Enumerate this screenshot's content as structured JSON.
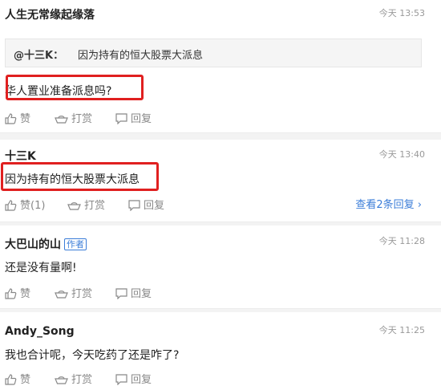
{
  "comments": [
    {
      "name": "人生无常缘起缘落",
      "time": "今天 13:53",
      "quote": {
        "name": "@十三K：",
        "text": "因为持有的恒大股票大派息"
      },
      "text": "华人置业准备派息吗?",
      "actions": {
        "like": "赞",
        "tip": "打赏",
        "reply": "回复"
      }
    },
    {
      "name": "十三K",
      "time": "今天 13:40",
      "text": "因为持有的恒大股票大派息",
      "actions": {
        "like": "赞(1)",
        "tip": "打赏",
        "reply": "回复"
      },
      "more_replies": "查看2条回复"
    },
    {
      "name": "大巴山的山",
      "badge": "作者",
      "time": "今天 11:28",
      "text": "还是没有量啊!",
      "actions": {
        "like": "赞",
        "tip": "打赏",
        "reply": "回复"
      }
    },
    {
      "name": "Andy_Song",
      "time": "今天 11:25",
      "text": "我也合计呢，今天吃药了还是咋了?",
      "actions": {
        "like": "赞",
        "tip": "打赏",
        "reply": "回复"
      }
    }
  ],
  "colors": {
    "highlight": "#e02020",
    "link": "#3b7dd8",
    "muted": "#888888"
  },
  "icons": {
    "like": "thumbs-up-icon",
    "tip": "ingot-icon",
    "reply": "comment-icon",
    "more": "chevron-right-icon"
  }
}
